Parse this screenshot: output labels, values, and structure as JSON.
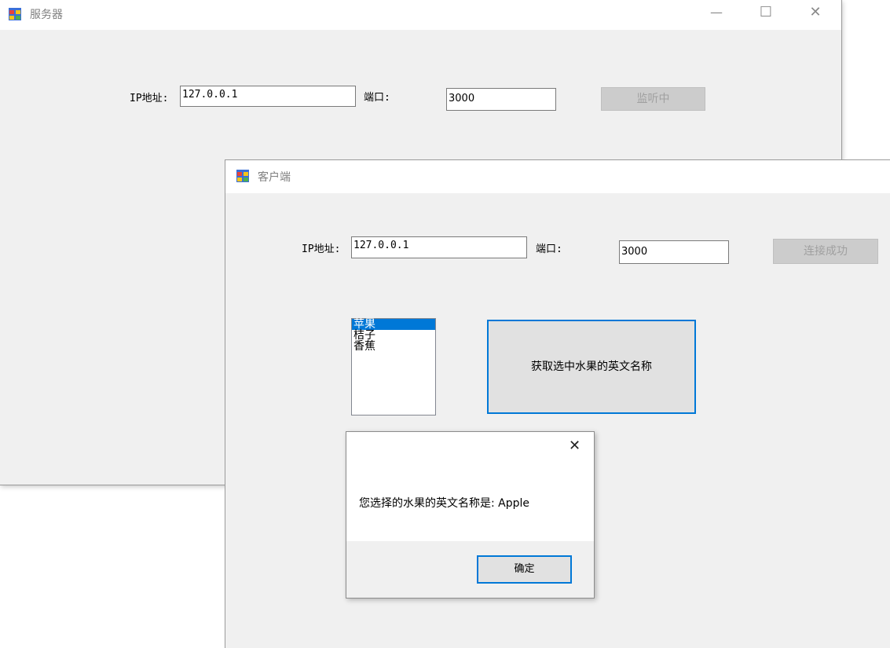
{
  "server_window": {
    "title": "服务器",
    "ip_label": "IP地址:",
    "ip_value": "127.0.0.1",
    "port_label": "端口:",
    "port_value": "3000",
    "listen_button": "监听中",
    "minimize_glyph": "—",
    "maximize_glyph": "☐",
    "close_glyph": "✕"
  },
  "client_window": {
    "title": "客户端",
    "ip_label": "IP地址:",
    "ip_value": "127.0.0.1",
    "port_label": "端口:",
    "port_value": "3000",
    "connect_button": "连接成功",
    "fruit_list": [
      {
        "label": "苹果",
        "selected": true
      },
      {
        "label": "桔子",
        "selected": false
      },
      {
        "label": "香蕉",
        "selected": false
      }
    ],
    "get_english_button": "获取选中水果的英文名称"
  },
  "message_box": {
    "message": "您选择的水果的英文名称是: Apple",
    "ok_button": "确定",
    "close_glyph": "✕"
  },
  "colors": {
    "accent": "#0078d7",
    "window_bg": "#f0f0f0",
    "disabled_text": "#a0a0a0"
  },
  "icons": {
    "app_icon": "winforms-app-icon"
  }
}
